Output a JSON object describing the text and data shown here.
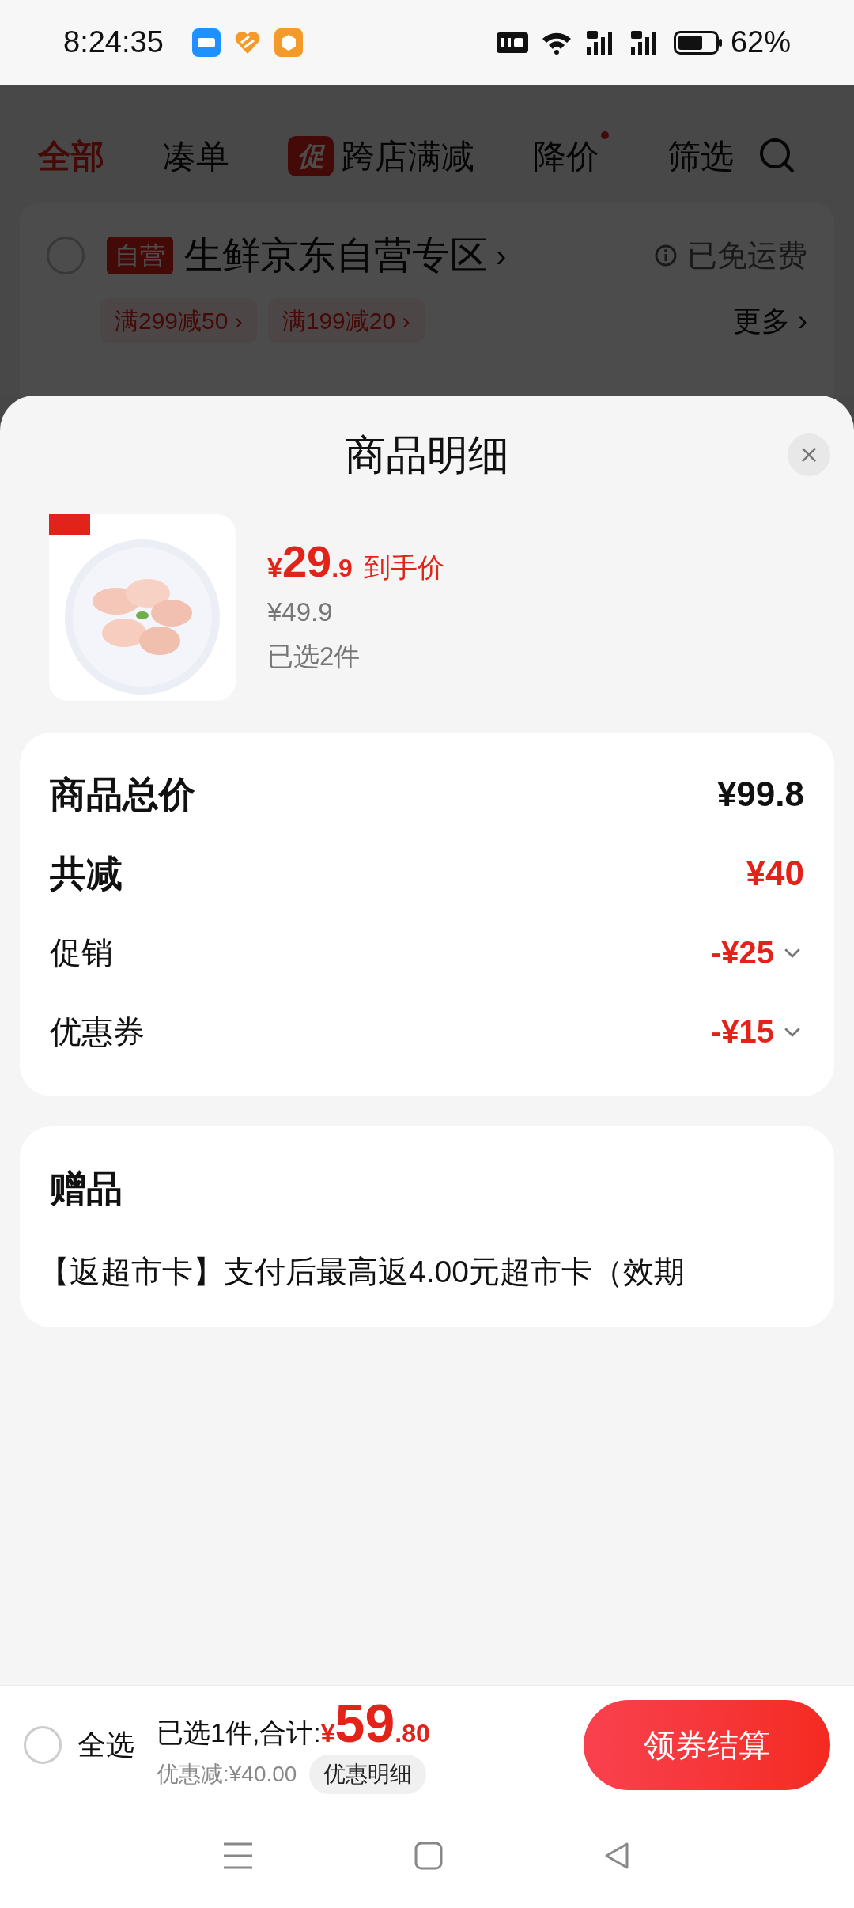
{
  "status_bar": {
    "time": "8:24:35",
    "battery": "62%"
  },
  "background_page": {
    "tabs": [
      {
        "label": "全部",
        "selected": true,
        "kind": "plain",
        "dot": false
      },
      {
        "label": "凑单",
        "selected": false,
        "kind": "plain",
        "dot": false
      },
      {
        "label": "跨店满减",
        "selected": false,
        "kind": "promo",
        "tag": "促",
        "dot": false
      },
      {
        "label": "降价",
        "selected": false,
        "kind": "plain",
        "dot": true
      },
      {
        "label": "筛选",
        "selected": false,
        "kind": "plain",
        "dot": false
      }
    ],
    "store": {
      "checked": false,
      "tag": "自营",
      "name": "生鲜京东自营专区",
      "arrow": "›",
      "shipping": "已免运费",
      "offers": [
        "满299减50 ›",
        "满199减20 ›"
      ],
      "more": "更多 ›"
    }
  },
  "sheet": {
    "title": "商品明细",
    "product": {
      "currency": "¥",
      "price_int": "29",
      "price_dec": ".9",
      "price_label": "到手价",
      "original_price": "¥49.9",
      "selected_count": "已选2件"
    },
    "summary": {
      "rows": [
        {
          "label": "商品总价",
          "value": "¥99.8",
          "kind": "total"
        },
        {
          "label": "共减",
          "value": "¥40",
          "kind": "discount_total"
        },
        {
          "label": "促销",
          "value": "-¥25",
          "kind": "discount"
        },
        {
          "label": "优惠券",
          "value": "-¥15",
          "kind": "discount"
        }
      ]
    },
    "gift": {
      "title": "赠品",
      "text": "【返超市卡】支付后最高返4.00元超市卡（效期"
    }
  },
  "bottom_bar": {
    "select_all": {
      "label": "全选",
      "checked": false
    },
    "selected_total": "已选1件,合计:",
    "currency": "¥",
    "total_int": "59",
    "total_dec": ".80",
    "saved": "优惠减:¥40.00",
    "detail_button": "优惠明细",
    "checkout_button": "领券结算"
  }
}
